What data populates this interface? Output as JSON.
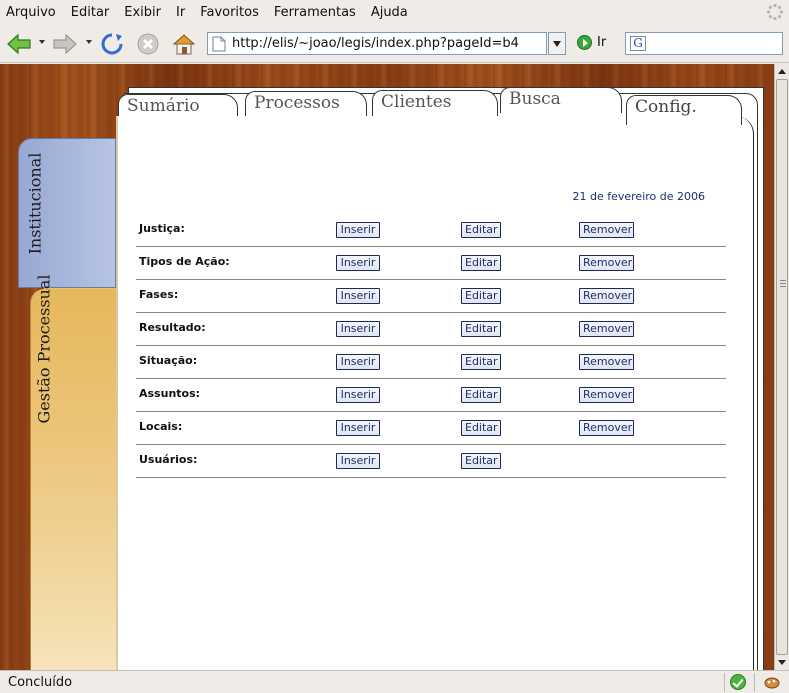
{
  "menu": {
    "items": [
      {
        "label": "Arquivo"
      },
      {
        "label": "Editar"
      },
      {
        "label": "Exibir"
      },
      {
        "label": "Ir"
      },
      {
        "label": "Favoritos"
      },
      {
        "label": "Ferramentas"
      },
      {
        "label": "Ajuda"
      }
    ]
  },
  "toolbar": {
    "url": "http://elis/~joao/legis/index.php?pageId=b4",
    "go_label": "Ir"
  },
  "tabs": [
    {
      "label": "Sumário"
    },
    {
      "label": "Processos"
    },
    {
      "label": "Clientes"
    },
    {
      "label": "Busca"
    },
    {
      "label": "Config."
    }
  ],
  "side_tabs": {
    "institucional": "Institucional",
    "gestao": "Gestão Processual"
  },
  "page": {
    "date": "21 de fevereiro de 2006",
    "rows": [
      {
        "label": "Justiça:",
        "insert": "Inserir",
        "edit": "Editar",
        "remove": "Remover"
      },
      {
        "label": "Tipos de Ação:",
        "insert": "Inserir",
        "edit": "Editar",
        "remove": "Remover"
      },
      {
        "label": "Fases:",
        "insert": "Inserir",
        "edit": "Editar",
        "remove": "Remover"
      },
      {
        "label": "Resultado:",
        "insert": "Inserir",
        "edit": "Editar",
        "remove": "Remover"
      },
      {
        "label": "Situação:",
        "insert": "Inserir",
        "edit": "Editar",
        "remove": "Remover"
      },
      {
        "label": "Assuntos:",
        "insert": "Inserir",
        "edit": "Editar",
        "remove": "Remover"
      },
      {
        "label": "Locais:",
        "insert": "Inserir",
        "edit": "Editar",
        "remove": "Remover"
      },
      {
        "label": "Usuários:",
        "insert": "Inserir",
        "edit": "Editar"
      }
    ]
  },
  "status": {
    "text": "Concluído"
  },
  "colors": {
    "accent_text": "#1c2f6b",
    "institucional_tab": "#a9b8df",
    "gestao_tab": "#e9bf6e",
    "wood": "#8e4317"
  }
}
